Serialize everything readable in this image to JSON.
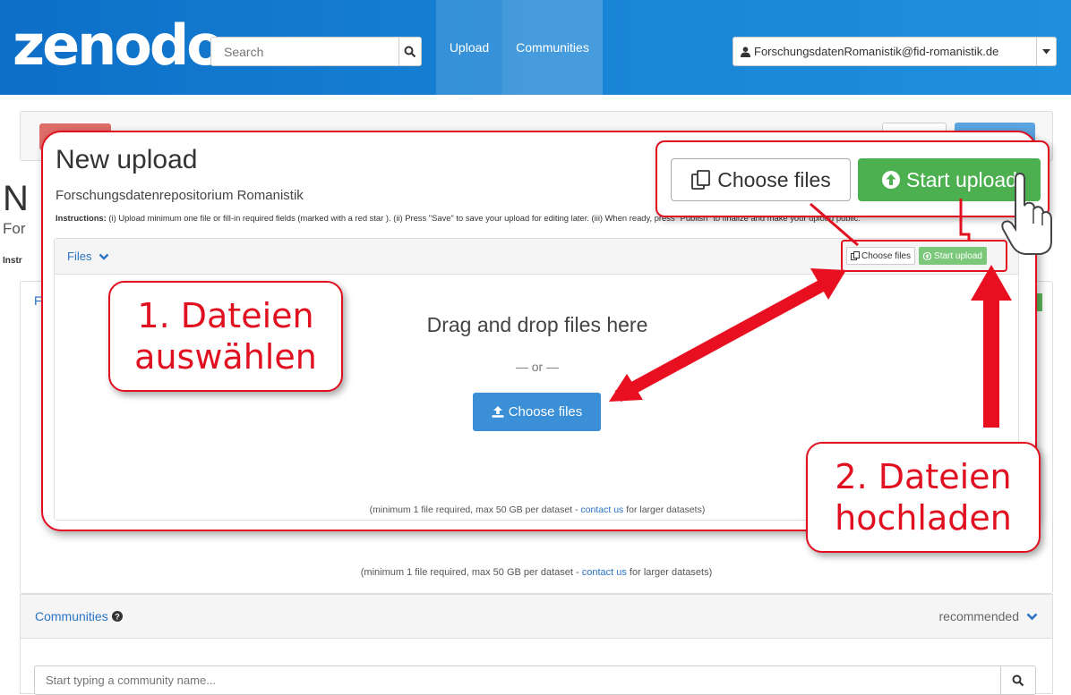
{
  "navbar": {
    "logo": "zenodo",
    "search_placeholder": "Search",
    "nav": {
      "upload": "Upload",
      "communities": "Communities"
    },
    "user_email": "ForschungsdatenRomanistik@fid-romanistik.de"
  },
  "background": {
    "big_letter": "N",
    "for_text": "For",
    "instr_text": "Instr",
    "f_text": "F",
    "min_note_prefix": "(minimum 1 file required, max 50 GB per dataset - ",
    "min_note_link": "contact us",
    "min_note_suffix": " for larger datasets)"
  },
  "communities": {
    "title": "Communities",
    "recommended": "recommended",
    "input_placeholder": "Start typing a community name..."
  },
  "upload_panel": {
    "title": "New upload",
    "subtitle": "Forschungsdatenrepositorium Romanistik",
    "instructions_label": "Instructions:",
    "instructions_text": " (i) Upload minimum one file or fill-in required fields (marked with a red star ). (ii) Press \"Save\" to save your upload for editing later. (iii) When ready, press \"Publish\" to finalize and make your upload public.",
    "files_title": "Files",
    "small_choose": "Choose files",
    "small_start": "Start upload",
    "drag_text": "Drag and drop files here",
    "or_text": "— or —",
    "choose_button": "Choose files",
    "min_note_prefix": "(minimum 1 file required, max 50 GB per dataset - ",
    "min_note_link": "contact us",
    "min_note_suffix": " for larger datasets)"
  },
  "zoom": {
    "choose_files": "Choose files",
    "start_upload": "Start upload"
  },
  "steps": {
    "step1_line1": "1. Dateien",
    "step1_line2": "auswählen",
    "step2_line1": "2. Dateien",
    "step2_line2": "hochladen"
  },
  "colors": {
    "accent_red": "#e01020",
    "nav_blue": "#1a86d6",
    "button_blue": "#3a8fd6",
    "button_green": "#4cb050"
  }
}
